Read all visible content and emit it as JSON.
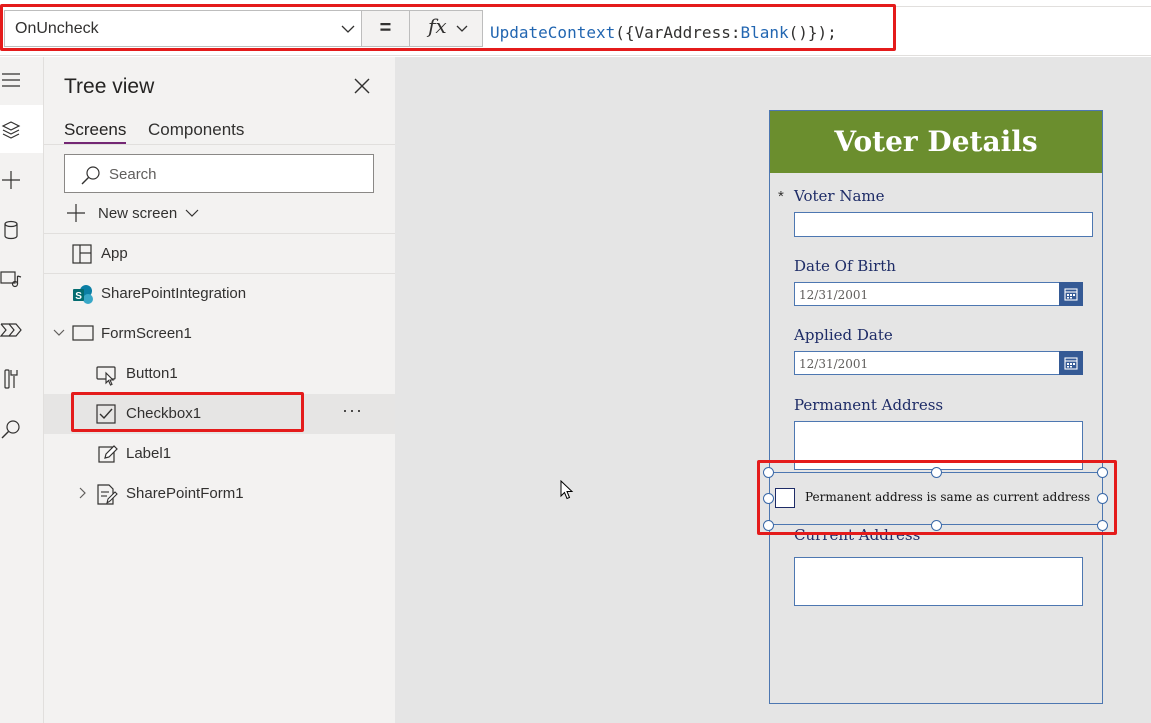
{
  "formula_bar": {
    "property": "OnUncheck",
    "equals": "=",
    "fx_label": "fx",
    "formula": {
      "fn": "UpdateContext",
      "open": "({",
      "var": "VarAddress:",
      "fn2": "Blank",
      "close": "()});"
    }
  },
  "rail": {
    "items": [
      "hamburger-icon",
      "layers-icon",
      "plus-icon",
      "database-icon",
      "media-icon",
      "power-automate-icon",
      "tools-icon",
      "search-icon"
    ],
    "active": "layers-icon"
  },
  "tree_view": {
    "title": "Tree view",
    "tabs": [
      "Screens",
      "Components"
    ],
    "active_tab": "Screens",
    "search_placeholder": "Search",
    "new_screen_label": "New screen",
    "nodes": {
      "app": "App",
      "sharepoint_integration": "SharePointIntegration",
      "form_screen": "FormScreen1",
      "button": "Button1",
      "checkbox": "Checkbox1",
      "label": "Label1",
      "sharepoint_form": "SharePointForm1"
    },
    "more_label": "···",
    "selected_node": "Checkbox1"
  },
  "form": {
    "title": "Voter Details",
    "required_marker": "*",
    "voter_name_label": "Voter Name",
    "voter_name_value": "",
    "dob_label": "Date Of Birth",
    "dob_value": "12/31/2001",
    "applied_date_label": "Applied Date",
    "applied_date_value": "12/31/2001",
    "permanent_address_label": "Permanent Address",
    "checkbox_text": "Permanent address is same as current address",
    "checkbox_checked": false,
    "current_address_label": "Current Address"
  },
  "colors": {
    "accent_purple": "#742774",
    "highlight_red": "#e41b1b",
    "form_header_green": "#6b8e2e",
    "form_border_blue": "#4d77b1",
    "label_navy": "#1e2c67"
  }
}
